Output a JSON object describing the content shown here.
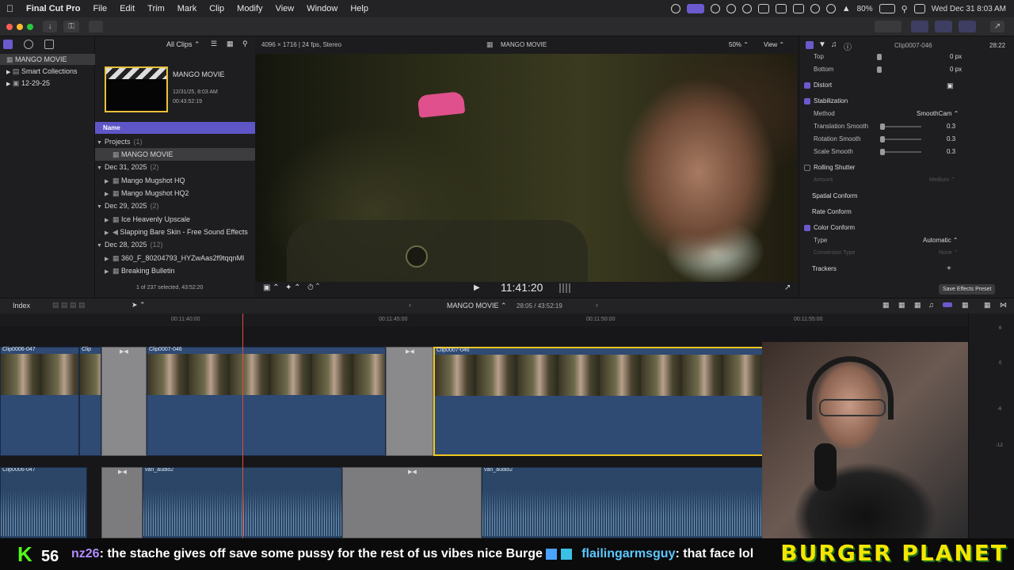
{
  "menubar": {
    "apple": "",
    "app": "Final Cut Pro",
    "items": [
      "File",
      "Edit",
      "Trim",
      "Mark",
      "Clip",
      "Modify",
      "View",
      "Window",
      "Help"
    ],
    "battery": "80%",
    "datetime": "Wed Dec 31  8:03 AM"
  },
  "library": {
    "items": [
      {
        "label": "MANGO MOVIE",
        "selected": true
      },
      {
        "label": "Smart Collections",
        "selected": false
      },
      {
        "label": "12-29-25",
        "selected": false
      }
    ]
  },
  "browser": {
    "filter": "All Clips",
    "project": {
      "title": "MANGO MOVIE",
      "date": "12/31/25, 8:03 AM",
      "duration": "00:43:52:19"
    },
    "column_header": "Name",
    "rows": [
      {
        "label": "Projects",
        "count": "(1)",
        "type": "group"
      },
      {
        "label": "MANGO MOVIE",
        "count": "",
        "type": "item-selected"
      },
      {
        "label": "Dec 31, 2025",
        "count": "(2)",
        "type": "group"
      },
      {
        "label": "Mango Mugshot HQ",
        "count": "",
        "type": "item"
      },
      {
        "label": "Mango Mugshot HQ2",
        "count": "",
        "type": "item"
      },
      {
        "label": "Dec 29, 2025",
        "count": "(2)",
        "type": "group"
      },
      {
        "label": "Ice Heavenly Upscale",
        "count": "",
        "type": "item"
      },
      {
        "label": "Slapping Bare Skin - Free Sound Effects",
        "count": "",
        "type": "item"
      },
      {
        "label": "Dec 28, 2025",
        "count": "(12)",
        "type": "group"
      },
      {
        "label": "360_F_80204793_HYZwAas2f9tqqnMl",
        "count": "",
        "type": "item"
      },
      {
        "label": "Breaking Bulletin",
        "count": "",
        "type": "item"
      }
    ],
    "selection_status": "1 of 237 selected, 43:52:20"
  },
  "viewer": {
    "format": "4096 × 1716 | 24 fps, Stereo",
    "title": "MANGO MOVIE",
    "zoom": "50%",
    "view_label": "View",
    "timecode": "11:41:20"
  },
  "inspector": {
    "clip_name": "Clip0007-046",
    "duration": "28:22",
    "rows": [
      {
        "label": "Top",
        "value": "0 px",
        "kind": "param"
      },
      {
        "label": "Bottom",
        "value": "0 px",
        "kind": "param"
      },
      {
        "label": "Distort",
        "value": "",
        "kind": "section-on"
      },
      {
        "label": "Stabilization",
        "value": "",
        "kind": "section-on"
      },
      {
        "label": "Method",
        "value": "SmoothCam ⌃",
        "kind": "param"
      },
      {
        "label": "Translation Smooth",
        "value": "0.3",
        "kind": "slider"
      },
      {
        "label": "Rotation Smooth",
        "value": "0.3",
        "kind": "slider"
      },
      {
        "label": "Scale Smooth",
        "value": "0.3",
        "kind": "slider"
      },
      {
        "label": "Rolling Shutter",
        "value": "",
        "kind": "section-off"
      },
      {
        "label": "Amount",
        "value": "Medium ⌃",
        "kind": "param-dim"
      },
      {
        "label": "Spatial Conform",
        "value": "",
        "kind": "section"
      },
      {
        "label": "Rate Conform",
        "value": "",
        "kind": "section"
      },
      {
        "label": "Color Conform",
        "value": "",
        "kind": "section-on"
      },
      {
        "label": "Type",
        "value": "Automatic ⌃",
        "kind": "param"
      },
      {
        "label": "Conversion Type",
        "value": "None ⌃",
        "kind": "param-dim"
      },
      {
        "label": "Trackers",
        "value": "+",
        "kind": "section"
      }
    ],
    "save_preset": "Save Effects Preset"
  },
  "timeline": {
    "index_label": "Index",
    "project": "MANGO MOVIE",
    "position": "28:05 / 43:52:19",
    "ruler": [
      "00:11:40:00",
      "00:11:45:00",
      "00:11:50:00",
      "00:11:55:00"
    ],
    "video_clips": [
      "Clip0006-047",
      "Clip",
      "Clip0007-046",
      "Clip0007-046"
    ],
    "audio_clips": [
      "Clip0006-047",
      "van_audio2",
      "van_audio2"
    ],
    "meter_ticks": [
      "6",
      "0",
      "-6",
      "-12"
    ]
  },
  "stream": {
    "kick_icon": "K",
    "viewers": "56",
    "chat": [
      {
        "user": "nz26",
        "text": ": the stache gives off save some pussy for the rest of us vibes nice Burge "
      },
      {
        "user": "flailingarmsguy",
        "text": ": that face lol"
      }
    ],
    "brand": "BURGER PLANET"
  }
}
